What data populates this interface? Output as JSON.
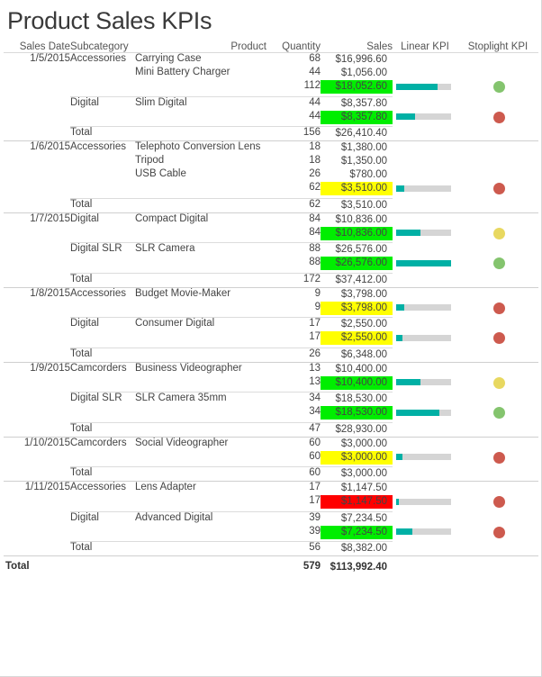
{
  "report": {
    "title": "Product Sales KPIs"
  },
  "table": {
    "columns": [
      {
        "key": "sales_date",
        "label": "Sales Date"
      },
      {
        "key": "subcategory",
        "label": "Subcategory"
      },
      {
        "key": "product",
        "label": "Product"
      },
      {
        "key": "quantity",
        "label": "Quantity"
      },
      {
        "key": "sales",
        "label": "Sales"
      },
      {
        "key": "linear_kpi",
        "label": "Linear KPI"
      },
      {
        "key": "stoplight_kpi",
        "label": "Stoplight KPI"
      }
    ],
    "total_row_label": "Total",
    "grand_total_label": "Total",
    "grand_total_quantity": "579",
    "grand_total_sales": "$113,992.40",
    "rows": [
      {
        "type": "detail",
        "date": "1/5/2015",
        "subcategory": "Accessories",
        "product": "Carrying Case",
        "quantity": "68",
        "sales": "$16,996.60"
      },
      {
        "type": "detail",
        "date": "",
        "subcategory": "",
        "product": "Mini Battery Charger",
        "quantity": "44",
        "sales": "$1,056.00"
      },
      {
        "type": "subtotal",
        "date": "",
        "subcategory": "",
        "product": "",
        "quantity": "112",
        "sales": "$18,052.60",
        "highlight": "green",
        "bar_percent": 75,
        "stoplight": "green"
      },
      {
        "type": "detail",
        "date": "",
        "subcategory": "Digital",
        "product": "Slim Digital",
        "quantity": "44",
        "sales": "$8,357.80"
      },
      {
        "type": "subtotal",
        "date": "",
        "subcategory": "",
        "product": "",
        "quantity": "44",
        "sales": "$8,357.80",
        "highlight": "green",
        "bar_percent": 35,
        "stoplight": "red"
      },
      {
        "type": "datetotal",
        "date": "",
        "subcategory": "Total",
        "product": "",
        "quantity": "156",
        "sales": "$26,410.40"
      },
      {
        "type": "detail",
        "date": "1/6/2015",
        "subcategory": "Accessories",
        "product": "Telephoto Conversion Lens",
        "quantity": "18",
        "sales": "$1,380.00"
      },
      {
        "type": "detail",
        "date": "",
        "subcategory": "",
        "product": "Tripod",
        "quantity": "18",
        "sales": "$1,350.00"
      },
      {
        "type": "detail",
        "date": "",
        "subcategory": "",
        "product": "USB Cable",
        "quantity": "26",
        "sales": "$780.00"
      },
      {
        "type": "subtotal",
        "date": "",
        "subcategory": "",
        "product": "",
        "quantity": "62",
        "sales": "$3,510.00",
        "highlight": "yellow",
        "bar_percent": 14,
        "stoplight": "red"
      },
      {
        "type": "datetotal",
        "date": "",
        "subcategory": "Total",
        "product": "",
        "quantity": "62",
        "sales": "$3,510.00"
      },
      {
        "type": "detail",
        "date": "1/7/2015",
        "subcategory": "Digital",
        "product": "Compact Digital",
        "quantity": "84",
        "sales": "$10,836.00"
      },
      {
        "type": "subtotal",
        "date": "",
        "subcategory": "",
        "product": "",
        "quantity": "84",
        "sales": "$10,836.00",
        "highlight": "green",
        "bar_percent": 45,
        "stoplight": "yellow"
      },
      {
        "type": "detail",
        "date": "",
        "subcategory": "Digital SLR",
        "product": "SLR Camera",
        "quantity": "88",
        "sales": "$26,576.00"
      },
      {
        "type": "subtotal",
        "date": "",
        "subcategory": "",
        "product": "",
        "quantity": "88",
        "sales": "$26,576.00",
        "highlight": "green",
        "bar_percent": 100,
        "stoplight": "green"
      },
      {
        "type": "datetotal",
        "date": "",
        "subcategory": "Total",
        "product": "",
        "quantity": "172",
        "sales": "$37,412.00"
      },
      {
        "type": "detail",
        "date": "1/8/2015",
        "subcategory": "Accessories",
        "product": "Budget Movie-Maker",
        "quantity": "9",
        "sales": "$3,798.00"
      },
      {
        "type": "subtotal",
        "date": "",
        "subcategory": "",
        "product": "",
        "quantity": "9",
        "sales": "$3,798.00",
        "highlight": "yellow",
        "bar_percent": 15,
        "stoplight": "red"
      },
      {
        "type": "detail",
        "date": "",
        "subcategory": "Digital",
        "product": "Consumer Digital",
        "quantity": "17",
        "sales": "$2,550.00"
      },
      {
        "type": "subtotal",
        "date": "",
        "subcategory": "",
        "product": "",
        "quantity": "17",
        "sales": "$2,550.00",
        "highlight": "yellow",
        "bar_percent": 12,
        "stoplight": "red"
      },
      {
        "type": "datetotal",
        "date": "",
        "subcategory": "Total",
        "product": "",
        "quantity": "26",
        "sales": "$6,348.00"
      },
      {
        "type": "detail",
        "date": "1/9/2015",
        "subcategory": "Camcorders",
        "product": "Business Videographer",
        "quantity": "13",
        "sales": "$10,400.00"
      },
      {
        "type": "subtotal",
        "date": "",
        "subcategory": "",
        "product": "",
        "quantity": "13",
        "sales": "$10,400.00",
        "highlight": "green",
        "bar_percent": 44,
        "stoplight": "yellow"
      },
      {
        "type": "detail",
        "date": "",
        "subcategory": "Digital SLR",
        "product": "SLR Camera 35mm",
        "quantity": "34",
        "sales": "$18,530.00"
      },
      {
        "type": "subtotal",
        "date": "",
        "subcategory": "",
        "product": "",
        "quantity": "34",
        "sales": "$18,530.00",
        "highlight": "green",
        "bar_percent": 78,
        "stoplight": "green"
      },
      {
        "type": "datetotal",
        "date": "",
        "subcategory": "Total",
        "product": "",
        "quantity": "47",
        "sales": "$28,930.00"
      },
      {
        "type": "detail",
        "date": "1/10/2015",
        "subcategory": "Camcorders",
        "product": "Social Videographer",
        "quantity": "60",
        "sales": "$3,000.00"
      },
      {
        "type": "subtotal",
        "date": "",
        "subcategory": "",
        "product": "",
        "quantity": "60",
        "sales": "$3,000.00",
        "highlight": "yellow",
        "bar_percent": 12,
        "stoplight": "red"
      },
      {
        "type": "datetotal",
        "date": "",
        "subcategory": "Total",
        "product": "",
        "quantity": "60",
        "sales": "$3,000.00"
      },
      {
        "type": "detail",
        "date": "1/11/2015",
        "subcategory": "Accessories",
        "product": "Lens Adapter",
        "quantity": "17",
        "sales": "$1,147.50"
      },
      {
        "type": "subtotal",
        "date": "",
        "subcategory": "",
        "product": "",
        "quantity": "17",
        "sales": "$1,147.50",
        "highlight": "red",
        "bar_percent": 5,
        "stoplight": "red"
      },
      {
        "type": "detail",
        "date": "",
        "subcategory": "Digital",
        "product": "Advanced Digital",
        "quantity": "39",
        "sales": "$7,234.50"
      },
      {
        "type": "subtotal",
        "date": "",
        "subcategory": "",
        "product": "",
        "quantity": "39",
        "sales": "$7,234.50",
        "highlight": "green",
        "bar_percent": 30,
        "stoplight": "red"
      },
      {
        "type": "datetotal",
        "date": "",
        "subcategory": "Total",
        "product": "",
        "quantity": "56",
        "sales": "$8,382.00"
      }
    ]
  },
  "colors": {
    "highlight_green": "#00EE00",
    "highlight_yellow": "#FFFF00",
    "highlight_red": "#FF0000",
    "bar_fill": "#00B0A5",
    "bar_track": "#D5D5D5",
    "stoplight_green": "#84C46E",
    "stoplight_yellow": "#E8D860",
    "stoplight_red": "#CD5A4E",
    "text": "#444444"
  }
}
